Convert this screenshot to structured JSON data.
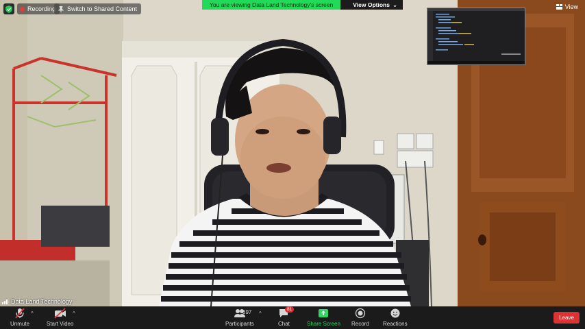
{
  "top": {
    "recording_label": "Recording",
    "switch_label": "Switch to Shared Content",
    "banner_text": "You are viewing Data Land Technology's screen",
    "view_options_label": "View Options",
    "view_label": "View"
  },
  "video": {
    "participant_name": "Data Land Technology"
  },
  "toolbar": {
    "unmute_label": "Unmute",
    "start_video_label": "Start Video",
    "participants_label": "Participants",
    "participants_count": "397",
    "chat_label": "Chat",
    "chat_badge": "81",
    "share_label": "Share Screen",
    "record_label": "Record",
    "reactions_label": "Reactions",
    "leave_label": "Leave"
  },
  "colors": {
    "banner_green": "#23d959",
    "share_green": "#2fd661",
    "leave_red": "#d83434",
    "recording_red": "#e8393a",
    "toolbar_bg": "#1b1b1b"
  }
}
